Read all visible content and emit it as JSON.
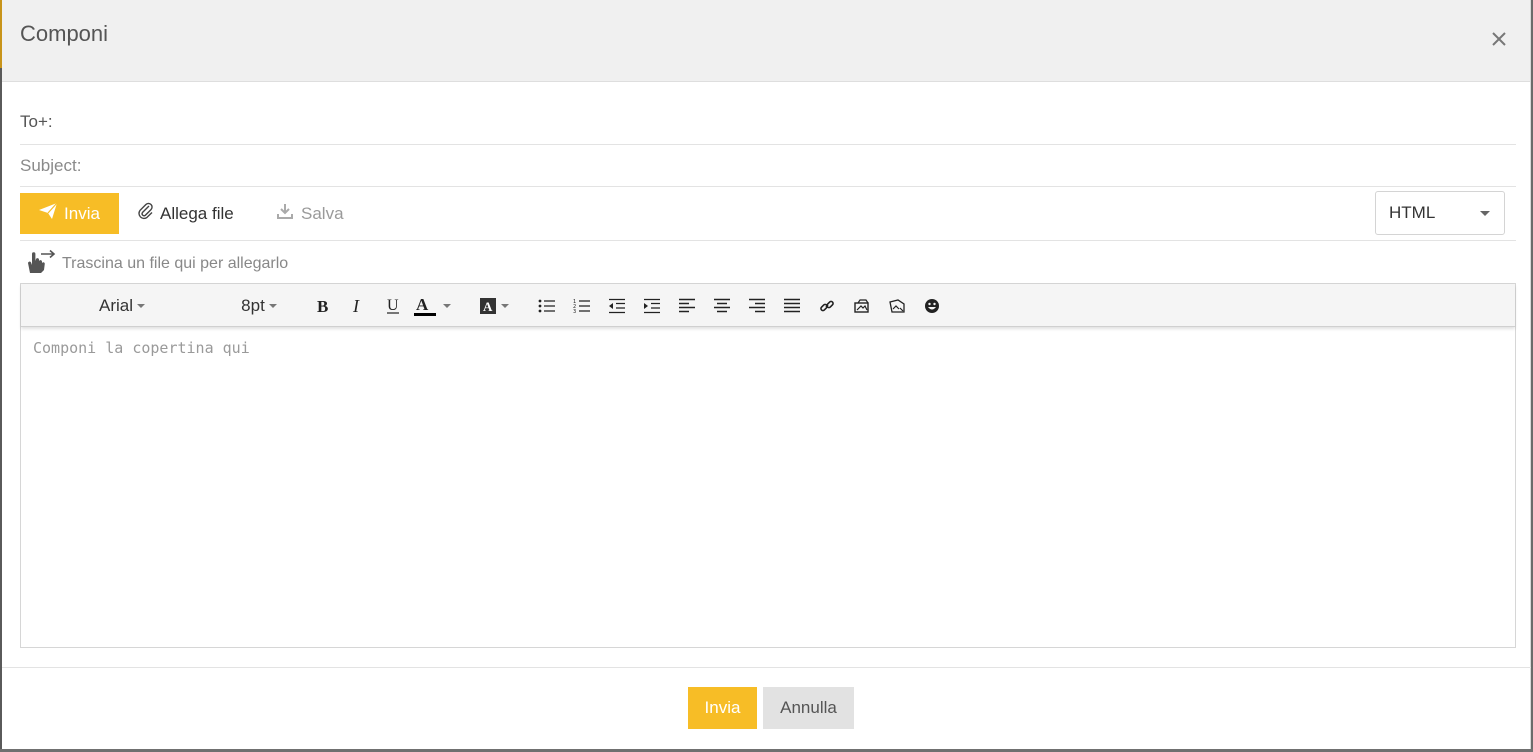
{
  "dialog": {
    "title": "Componi",
    "close_icon": "close-icon"
  },
  "fields": {
    "to_label": "To+:",
    "to_value": "",
    "subject_label": "Subject:",
    "subject_value": ""
  },
  "actions": {
    "send_label": "Invia",
    "attach_label": "Allega file",
    "save_label": "Salva",
    "format_selected": "HTML"
  },
  "dropzone": {
    "text": "Trascina un file qui per allegarlo"
  },
  "toolbar": {
    "font_family": "Arial",
    "font_size": "8pt",
    "buttons": [
      "bold-icon",
      "italic-icon",
      "underline-icon",
      "text-color-icon",
      "background-color-icon",
      "bullet-list-icon",
      "numbered-list-icon",
      "outdent-icon",
      "indent-icon",
      "align-left-icon",
      "align-center-icon",
      "align-right-icon",
      "justify-icon",
      "link-icon",
      "image-icon",
      "unlink-image-icon",
      "emoji-icon"
    ]
  },
  "editor": {
    "placeholder": "Componi la copertina qui"
  },
  "footer": {
    "send_label": "Invia",
    "cancel_label": "Annulla"
  },
  "colors": {
    "accent": "#f7bd26",
    "header_bg": "#f0f0f0",
    "cancel_bg": "#e2e2e2"
  }
}
